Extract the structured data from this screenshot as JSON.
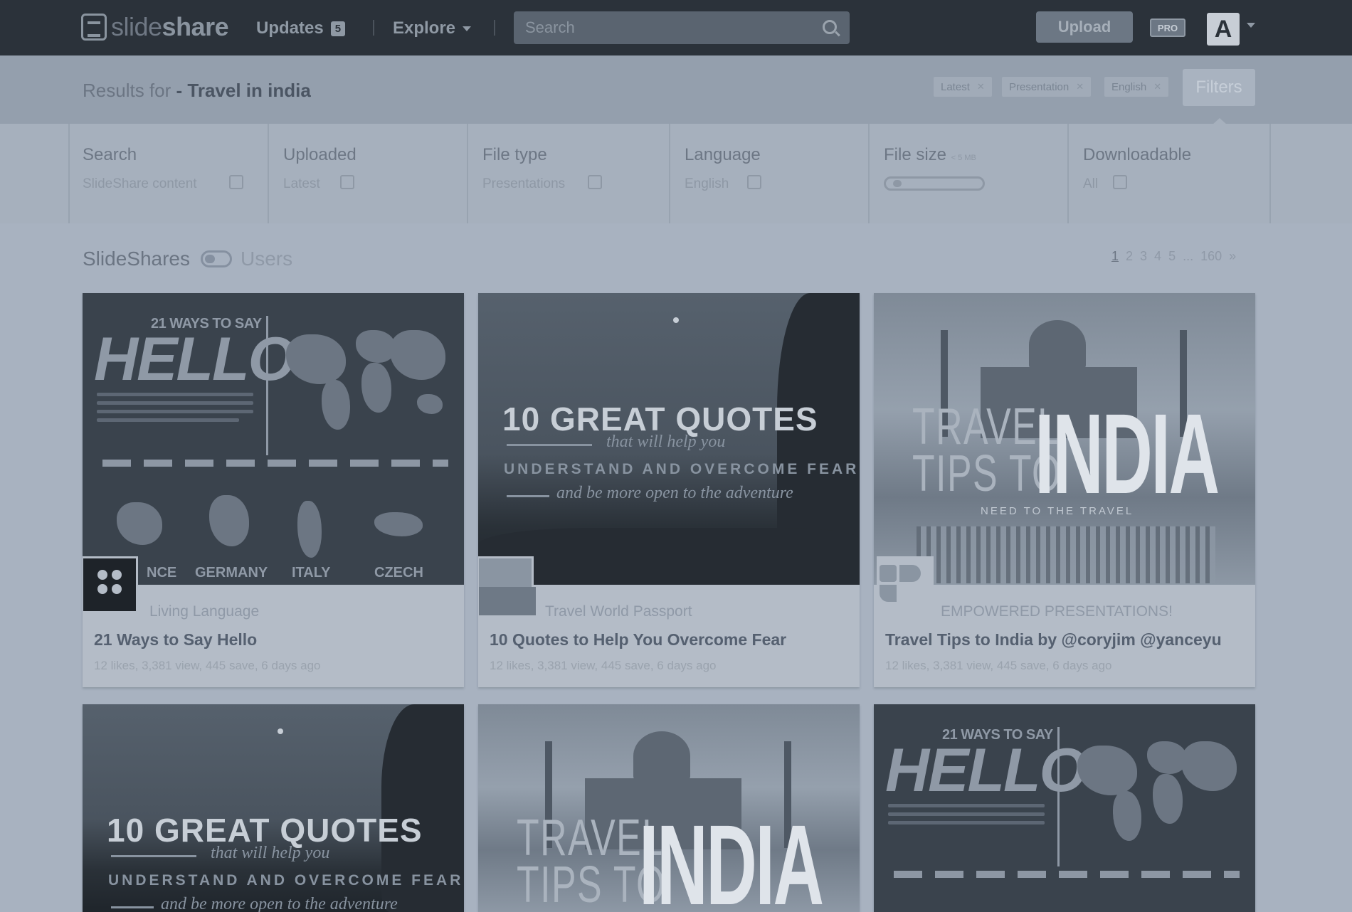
{
  "nav": {
    "logo": {
      "light": "slide",
      "bold": "share"
    },
    "updates_label": "Updates",
    "updates_count": "5",
    "explore_label": "Explore",
    "search_placeholder": "Search",
    "upload_label": "Upload",
    "pro_label": "PRO",
    "avatar_letter": "A"
  },
  "results": {
    "prefix": "Results for ",
    "query": "- Travel in india",
    "active_filters": [
      {
        "label": "Latest"
      },
      {
        "label": "Presentation"
      },
      {
        "label": "English"
      }
    ],
    "filters_button": "Filters"
  },
  "filter_panel": {
    "columns": [
      {
        "title": "Search",
        "value": "SlideShare content"
      },
      {
        "title": "Uploaded",
        "value": "Latest"
      },
      {
        "title": "File type",
        "value": "Presentations"
      },
      {
        "title": "Language",
        "value": "English"
      },
      {
        "title": "File size",
        "value": "",
        "hint": "< 5 MB",
        "slider_value": 0.05
      },
      {
        "title": "Downloadable",
        "value": "All"
      }
    ]
  },
  "list": {
    "section_title": "SlideShares",
    "users_label": "Users",
    "pagination": [
      "1",
      "2",
      "3",
      "4",
      "5",
      "...",
      "160",
      "»"
    ]
  },
  "cards": [
    {
      "author": "Living Language",
      "title": "21 Ways to Say Hello",
      "stats": "12 likes, 3,381 view, 445 save, 6 days ago",
      "thumb": {
        "small": "21 WAYS TO SAY",
        "big": "HELLO",
        "countries": [
          "NCE",
          "GERMANY",
          "ITALY",
          "CZECH"
        ]
      }
    },
    {
      "author": "Travel World Passport",
      "title": "10 Quotes to Help You Overcome Fear",
      "stats": "12 likes, 3,381 view, 445 save, 6 days ago",
      "thumb": {
        "big": "10 GREAT QUOTES",
        "script1": "that will help you",
        "caps": "UNDERSTAND AND OVERCOME FEAR",
        "script2": "and be more open to the adventure"
      }
    },
    {
      "author": "EMPOWERED PRESENTATIONS!",
      "title": "Travel Tips to India by @coryjim @yanceyu",
      "stats": "12 likes, 3,381 view, 445 save, 6 days ago",
      "thumb": {
        "line1": "TRAVEL",
        "line2": "TIPS TO",
        "big": "INDIA",
        "sub": "NEED TO THE TRAVEL"
      }
    }
  ],
  "cards_row2": [
    {
      "thumb": {
        "big": "10 GREAT QUOTES",
        "script1": "that will help you",
        "caps": "UNDERSTAND AND OVERCOME FEAR",
        "script2": "and be more open to the adventure"
      }
    },
    {
      "thumb": {
        "line1": "TRAVEL",
        "line2": "TIPS TO",
        "big": "INDIA"
      }
    },
    {
      "thumb": {
        "small": "21 WAYS TO SAY",
        "big": "HELLO"
      }
    }
  ]
}
